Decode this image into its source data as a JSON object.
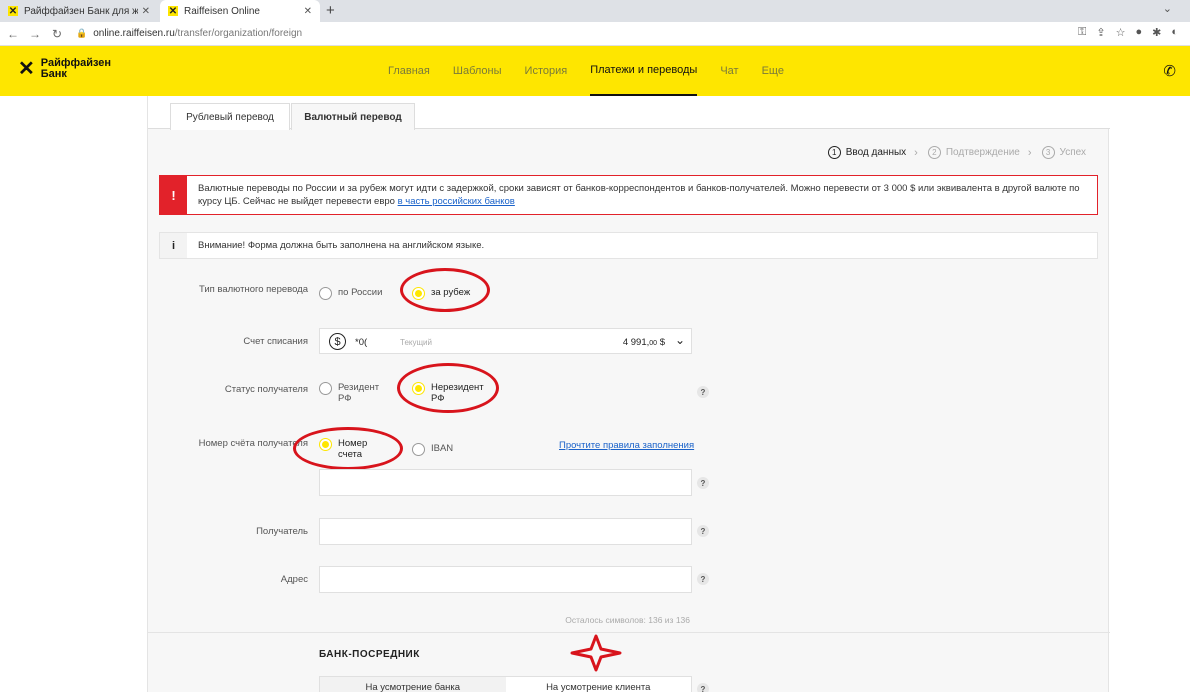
{
  "browser": {
    "tabs": [
      {
        "title": "Райффайзен Банк для жизни и",
        "close": "✕"
      },
      {
        "title": "Raiffeisen Online",
        "close": "✕"
      }
    ],
    "new_tab": "+",
    "url_host": "online.raiffeisen.ru",
    "url_path": "/transfer/organization/foreign"
  },
  "header": {
    "logo_line1": "Райффайзен",
    "logo_line2": "Банк",
    "nav": [
      "Главная",
      "Шаблоны",
      "История",
      "Платежи и переводы",
      "Чат",
      "Еще"
    ],
    "active_nav": "Платежи и переводы",
    "brand_color": "#fee600"
  },
  "page": {
    "tabs": [
      "Рублевый перевод",
      "Валютный перевод"
    ],
    "active_tab": "Валютный перевод",
    "steps": [
      {
        "num": "1",
        "label": "Ввод данных"
      },
      {
        "num": "2",
        "label": "Подтверждение"
      },
      {
        "num": "3",
        "label": "Успех"
      }
    ],
    "warning": {
      "text": "Валютные переводы по России и за рубеж могут идти с задержкой, сроки зависят от банков-корреспондентов и банков-получателей. Можно перевести от 3 000 $ или эквивалента в другой валюте по курсу ЦБ. Сейчас не выйдет перевести евро ",
      "link": "в часть российских банков",
      "icon": "!"
    },
    "info": {
      "text": "Внимание! Форма должна быть заполнена на английском языке.",
      "icon": "i"
    },
    "form": {
      "transfer_type_label": "Тип валютного перевода",
      "transfer_type_options": [
        "по России",
        "за рубеж"
      ],
      "transfer_type_selected": "за рубеж",
      "account_label": "Счет списания",
      "account_currency": "$",
      "account_number": "*0(",
      "account_type": "Текущий",
      "account_balance": "4 991,",
      "account_balance_cents": "00",
      "account_balance_currency": "$",
      "recipient_status_label": "Статус получателя",
      "recipient_status_options": [
        "Резидент РФ",
        "Нерезидент РФ"
      ],
      "recipient_status_selected": "Нерезидент РФ",
      "account_number_label": "Номер счёта получателя",
      "account_number_options": [
        "Номер счета",
        "IBAN"
      ],
      "account_number_selected": "Номер счета",
      "rules_link": "Прочтите правила заполнения",
      "recipient_label": "Получатель",
      "address_label": "Адрес",
      "chars_left": "Осталось символов: 136 из 136",
      "help": "?"
    },
    "intermediary": {
      "title": "БАНК-ПОСРЕДНИК",
      "options": [
        "На усмотрение банка",
        "На усмотрение клиента"
      ],
      "selected": "На усмотрение клиента"
    }
  },
  "annotation_color": "#d8141c"
}
